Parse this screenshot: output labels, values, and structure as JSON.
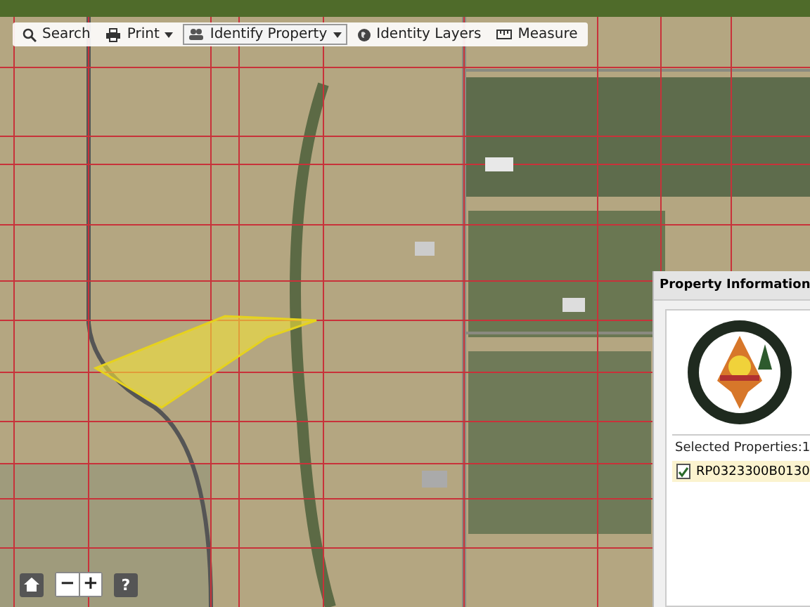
{
  "toolbar": [
    {
      "label": "Search",
      "dropdown": false,
      "selected": false
    },
    {
      "label": "Print",
      "dropdown": true,
      "selected": false
    },
    {
      "label": "Identify Property",
      "dropdown": true,
      "selected": true
    },
    {
      "label": "Identity Layers",
      "dropdown": false,
      "selected": false
    },
    {
      "label": "Measure",
      "dropdown": false,
      "selected": false
    }
  ],
  "property_panel": {
    "title": "Property Information",
    "selected_header": "Selected Properties:1",
    "properties": [
      {
        "label": "RP0323300B0130",
        "checked": true
      }
    ]
  },
  "map_controls": {
    "zoom_out": "−",
    "zoom_in": "+",
    "help": "?"
  }
}
